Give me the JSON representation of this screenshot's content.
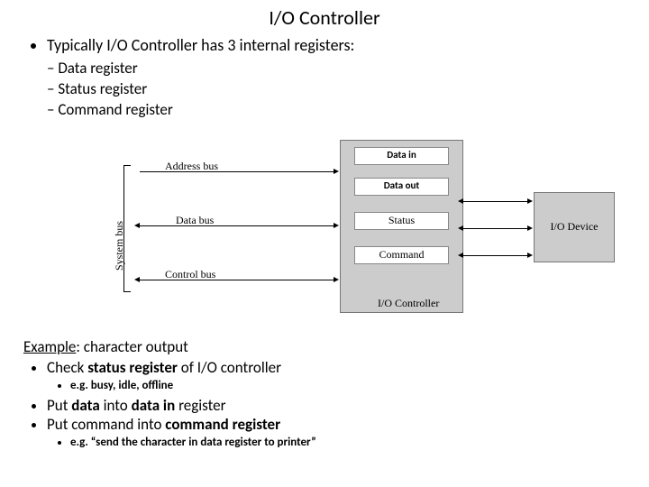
{
  "title": "I/O Controller",
  "bullets": {
    "main": "Typically I/O Controller has 3 internal registers:",
    "sub": [
      "Data register",
      "Status register",
      "Command register"
    ]
  },
  "diagram": {
    "system_bus": "System bus",
    "buses": [
      "Address bus",
      "Data bus",
      "Control bus"
    ],
    "controller_label": "I/O Controller",
    "registers": {
      "data_in": "Data in",
      "data_out": "Data out",
      "status": "Status",
      "command": "Command"
    },
    "device": "I/O Device"
  },
  "example": {
    "heading_u": "Example",
    "heading_rest": ": character output",
    "items": [
      {
        "pre": "Check ",
        "b": "status register",
        "post": " of I/O controller",
        "sub": "e.g. busy,  idle, offline"
      },
      {
        "pre": "Put ",
        "b": "data",
        "post_pre": " into ",
        "b2": "data in",
        "post": " register"
      },
      {
        "pre": "Put command into ",
        "b": "command register",
        "post": "",
        "sub": "e.g. “send the character in data register to printer”"
      }
    ]
  }
}
